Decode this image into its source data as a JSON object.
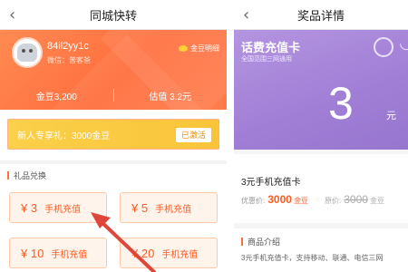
{
  "left_screen": {
    "title": "同城快转",
    "back_icon": "chevron-left-icon",
    "user": {
      "username": "84il2yy1c",
      "wechat": "微信：普客爸",
      "coin_detail_label": "金豆明细",
      "coins": "金豆3,200",
      "value": "估值 3.2元"
    },
    "promo": {
      "text": "新人专享礼：3000金豆",
      "button": "已激活"
    },
    "gift_section": {
      "title": "礼品兑换",
      "items": [
        {
          "price": "¥ 3",
          "name": "手机充值"
        },
        {
          "price": "¥ 5",
          "name": "手机充值"
        },
        {
          "price": "¥ 10",
          "name": "手机充值"
        },
        {
          "price": "¥ 20",
          "name": "手机充值"
        }
      ]
    }
  },
  "right_screen": {
    "title": "奖品详情",
    "back_icon": "chevron-left-icon",
    "card": {
      "title": "话费充值卡",
      "subtitle": "全国范围三网通用",
      "amount": "3",
      "unit": "元"
    },
    "product": {
      "name": "3元手机充值卡",
      "price_label": "优惠价:",
      "price": "3000",
      "price_unit": "金豆",
      "original_label": "原价:",
      "original_price": "3000",
      "original_unit": "金豆"
    },
    "intro": {
      "title": "商品介绍",
      "text": "3元手机充值卡，支持移动、联通、电信三网"
    }
  },
  "colors": {
    "orange": "#ff6f3e",
    "yellow": "#f9c43a",
    "purple": "#a07ed6",
    "arrow_red": "#e0453a"
  }
}
